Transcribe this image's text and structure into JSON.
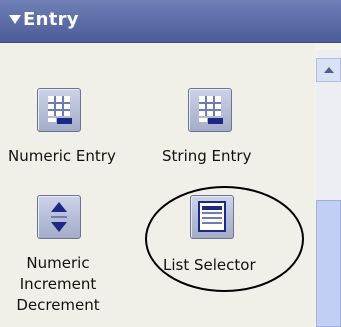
{
  "header": {
    "title": "Entry"
  },
  "tools": [
    {
      "label": "Numeric Entry",
      "icon": "keypad-icon"
    },
    {
      "label": "String Entry",
      "icon": "keypad-icon"
    },
    {
      "label": "Numeric Increment Decrement",
      "icon": "up-down-arrows-icon"
    },
    {
      "label": "List Selector",
      "icon": "list-icon"
    }
  ],
  "colors": {
    "header": "#5566a6",
    "panel": "#f0f0e8",
    "scroll_thumb": "#c3cff2"
  }
}
